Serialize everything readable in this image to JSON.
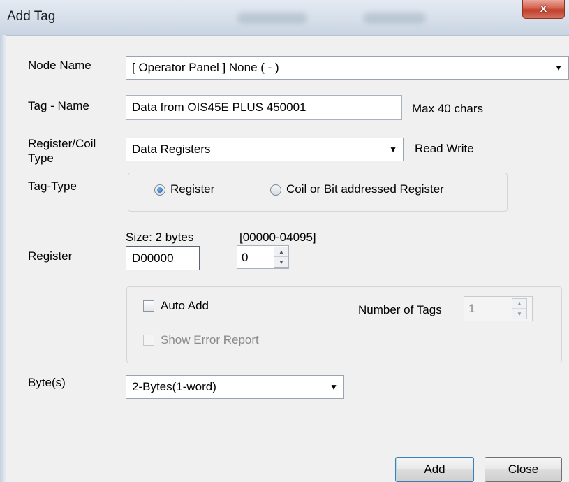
{
  "window": {
    "title": "Add Tag",
    "close_glyph": "x"
  },
  "labels": {
    "node_name": "Node Name",
    "tag_name": "Tag - Name",
    "register_coil_type": "Register/Coil\nType",
    "tag_type": "Tag-Type",
    "register": "Register",
    "bytes": "Byte(s)"
  },
  "node_name": {
    "selected": "[ Operator Panel ] None ( - )"
  },
  "tag_name": {
    "value": "Data from OIS45E PLUS  450001",
    "hint": "Max 40 chars"
  },
  "register_type": {
    "selected": "Data Registers",
    "access": "Read Write"
  },
  "tag_type": {
    "options": [
      {
        "label": "Register",
        "selected": true
      },
      {
        "label": "Coil or Bit addressed Register",
        "selected": false
      }
    ]
  },
  "register": {
    "size_text": "Size: 2 bytes",
    "range_text": "[00000-04095]",
    "address": "D00000",
    "offset": "0"
  },
  "auto_add": {
    "label": "Auto Add",
    "checked": false,
    "show_error_label": "Show Error Report",
    "number_of_tags_label": "Number of Tags",
    "number_of_tags_value": "1"
  },
  "bytes": {
    "selected": "2-Bytes(1-word)"
  },
  "buttons": {
    "add": "Add",
    "close": "Close"
  },
  "icons": {
    "dropdown": "chevron-down-icon",
    "spin_up": "arrow-up-icon",
    "spin_down": "arrow-down-icon"
  }
}
